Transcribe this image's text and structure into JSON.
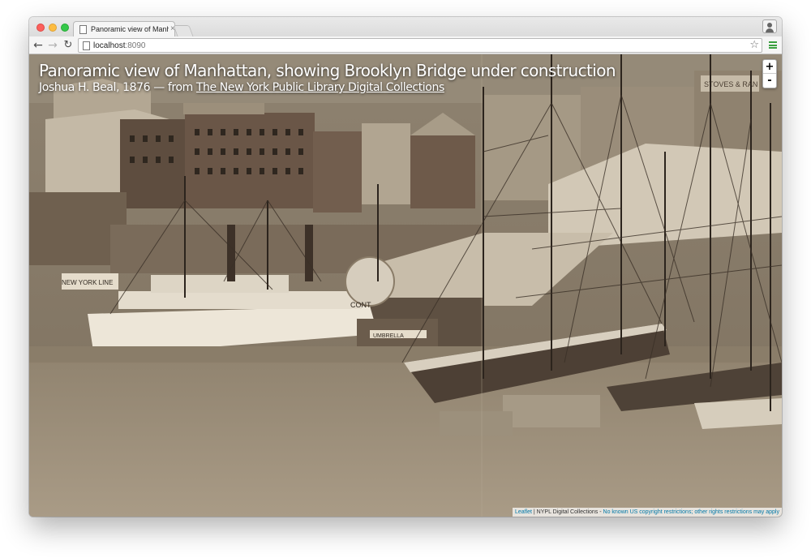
{
  "browser": {
    "tab_title": "Panoramic view of Manhatt",
    "tab_close": "×",
    "url_host": "localhost",
    "url_port": ":8090",
    "icons": {
      "back": "arrow-left-icon",
      "forward": "arrow-right-icon",
      "reload": "reload-icon",
      "bookmark": "star-icon",
      "menu": "hamburger-menu-icon",
      "profile": "person-icon"
    },
    "colors": {
      "close_light": "#fc605c",
      "minimize_light": "#fdbc40",
      "zoom_light": "#34c84a",
      "menu_accent": "#3aa03f"
    }
  },
  "map": {
    "title": "Panoramic view of Manhattan, showing Brooklyn Bridge under construction",
    "subtitle_prefix": "Joshua H. Beal, 1876 — from ",
    "subtitle_link": "The New York Public Library Digital Collections",
    "zoom_in_label": "+",
    "zoom_out_label": "-",
    "attribution": {
      "leaflet": "Leaflet",
      "separator": " | NYPL Digital Collections - ",
      "rights": "No known US copyright restrictions; other rights restrictions may apply"
    },
    "sign_texts": {
      "building_sign": "STOVES & RAN",
      "warehouse_sign": "NEW YORK LINE",
      "boat_name": "CONT",
      "dock_sign": "UMBRELLA"
    }
  }
}
